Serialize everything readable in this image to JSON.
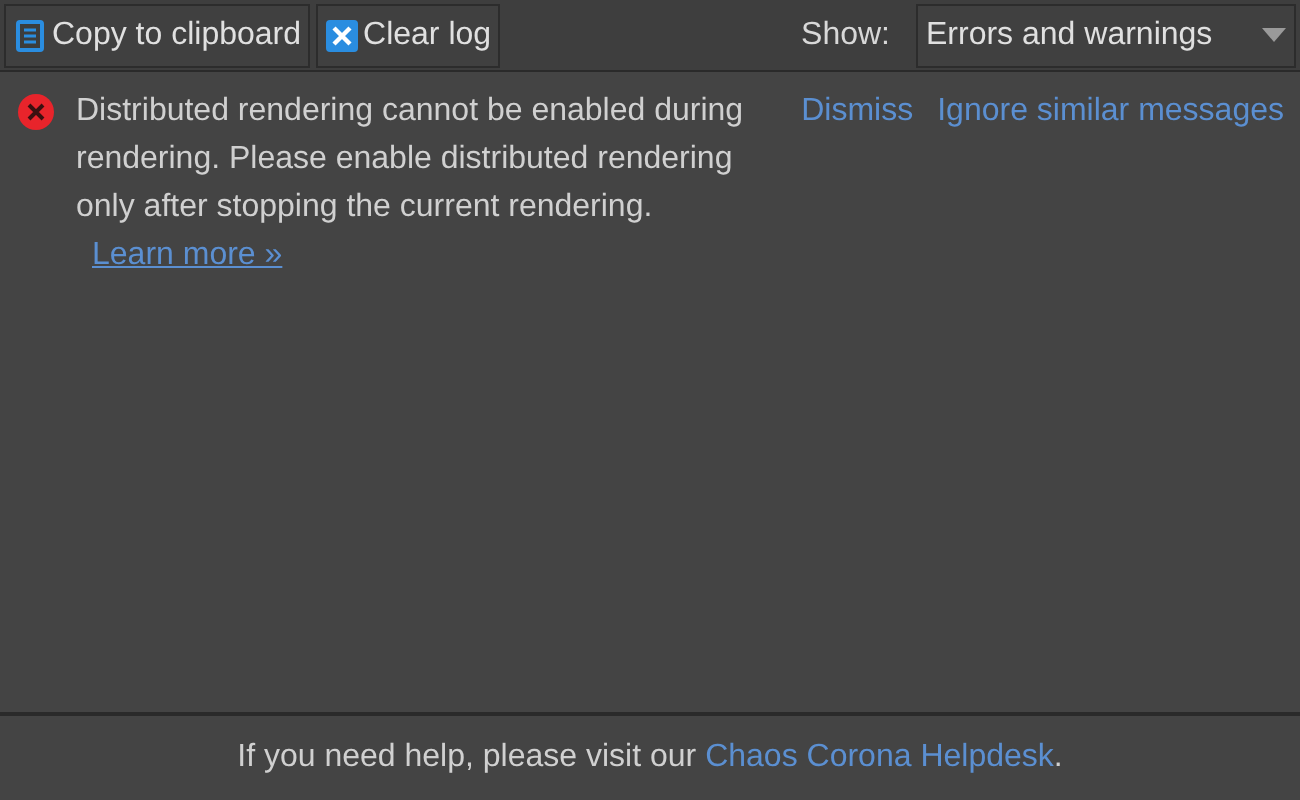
{
  "toolbar": {
    "buttons": [
      {
        "kind": "copy",
        "label": "Copy to clipboard"
      },
      {
        "kind": "clear",
        "label": "Clear log"
      }
    ],
    "filter": {
      "label": "Show:",
      "value": "Errors and warnings"
    }
  },
  "messages": [
    {
      "kind": "error",
      "text": "Distributed rendering cannot be enabled during rendering. Please enable distributed rendering only after stopping the current rendering.",
      "link": "Learn more »",
      "actions": [
        "Dismiss",
        "Ignore similar messages"
      ]
    }
  ],
  "footer": {
    "text": "If you need help, please visit our",
    "link": "Chaos Corona Helpdesk",
    "end": "."
  }
}
